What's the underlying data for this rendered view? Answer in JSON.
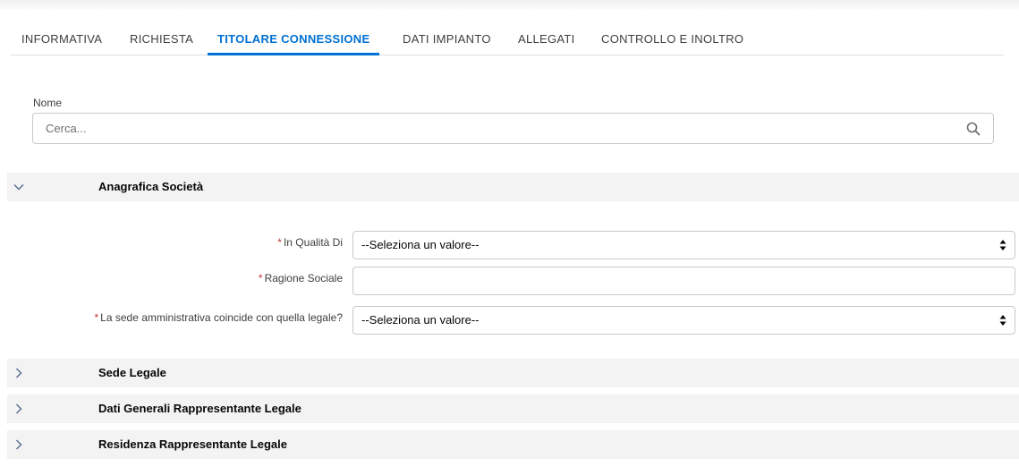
{
  "tabs": [
    {
      "label": "INFORMATIVA"
    },
    {
      "label": "RICHIESTA"
    },
    {
      "label": "TITOLARE CONNESSIONE"
    },
    {
      "label": "DATI IMPIANTO"
    },
    {
      "label": "ALLEGATI"
    },
    {
      "label": "CONTROLLO E INOLTRO"
    }
  ],
  "active_tab": "TITOLARE CONNESSIONE",
  "search": {
    "label": "Nome",
    "placeholder": "Cerca...",
    "value": "",
    "icon": "search-icon"
  },
  "sections": [
    {
      "title": "Anagrafica Società",
      "expanded": true,
      "icon": "chevron-down-icon"
    },
    {
      "title": "Sede Legale",
      "expanded": false,
      "icon": "chevron-right-icon"
    },
    {
      "title": "Dati Generali Rappresentante Legale",
      "expanded": false,
      "icon": "chevron-right-icon"
    },
    {
      "title": "Residenza Rappresentante Legale",
      "expanded": false,
      "icon": "chevron-right-icon"
    }
  ],
  "form": {
    "required_marker": "*",
    "in_qualita_di": {
      "label": "In Qualità Di",
      "value": "--Seleziona un valore--"
    },
    "ragione_sociale": {
      "label": "Ragione Sociale",
      "value": ""
    },
    "sede_coincide": {
      "label": "La sede amministrativa coincide con quella legale?",
      "value": "--Seleziona un valore--"
    }
  },
  "colors": {
    "accent": "#0070d2",
    "required": "#c23934",
    "section_bg": "#f3f3f3"
  }
}
